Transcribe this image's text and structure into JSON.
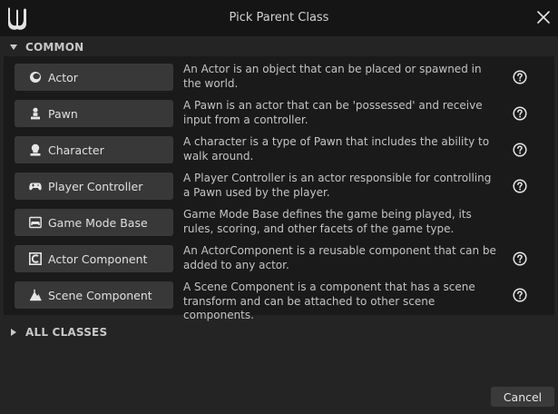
{
  "window": {
    "title": "Pick Parent Class",
    "logo_icon": "unreal-engine-logo",
    "close_icon": "close-icon"
  },
  "common_section": {
    "label": "COMMON",
    "expanded": true,
    "items": [
      {
        "label": "Actor",
        "icon": "actor-icon",
        "description": "An Actor is an object that can be placed or spawned in the world."
      },
      {
        "label": "Pawn",
        "icon": "pawn-icon",
        "description": "A Pawn is an actor that can be 'possessed' and receive input from a controller."
      },
      {
        "label": "Character",
        "icon": "character-icon",
        "description": "A character is a type of Pawn that includes the ability to walk around."
      },
      {
        "label": "Player Controller",
        "icon": "gamepad-icon",
        "description": "A Player Controller is an actor responsible for controlling a Pawn used by the player."
      },
      {
        "label": "Game Mode Base",
        "icon": "game-mode-icon",
        "description": "Game Mode Base defines the game being played, its rules, scoring, and other facets of the game type."
      },
      {
        "label": "Actor Component",
        "icon": "actor-component-icon",
        "description": "An ActorComponent is a reusable component that can be added to any actor."
      },
      {
        "label": "Scene Component",
        "icon": "scene-component-icon",
        "description": "A Scene Component is a component that has a scene transform and can be attached to other scene components."
      }
    ]
  },
  "all_classes_section": {
    "label": "ALL CLASSES",
    "expanded": false
  },
  "footer": {
    "cancel_label": "Cancel"
  },
  "colors": {
    "background": "#151515",
    "panel": "#242424",
    "button": "#383838",
    "text": "#c4c4c4"
  }
}
